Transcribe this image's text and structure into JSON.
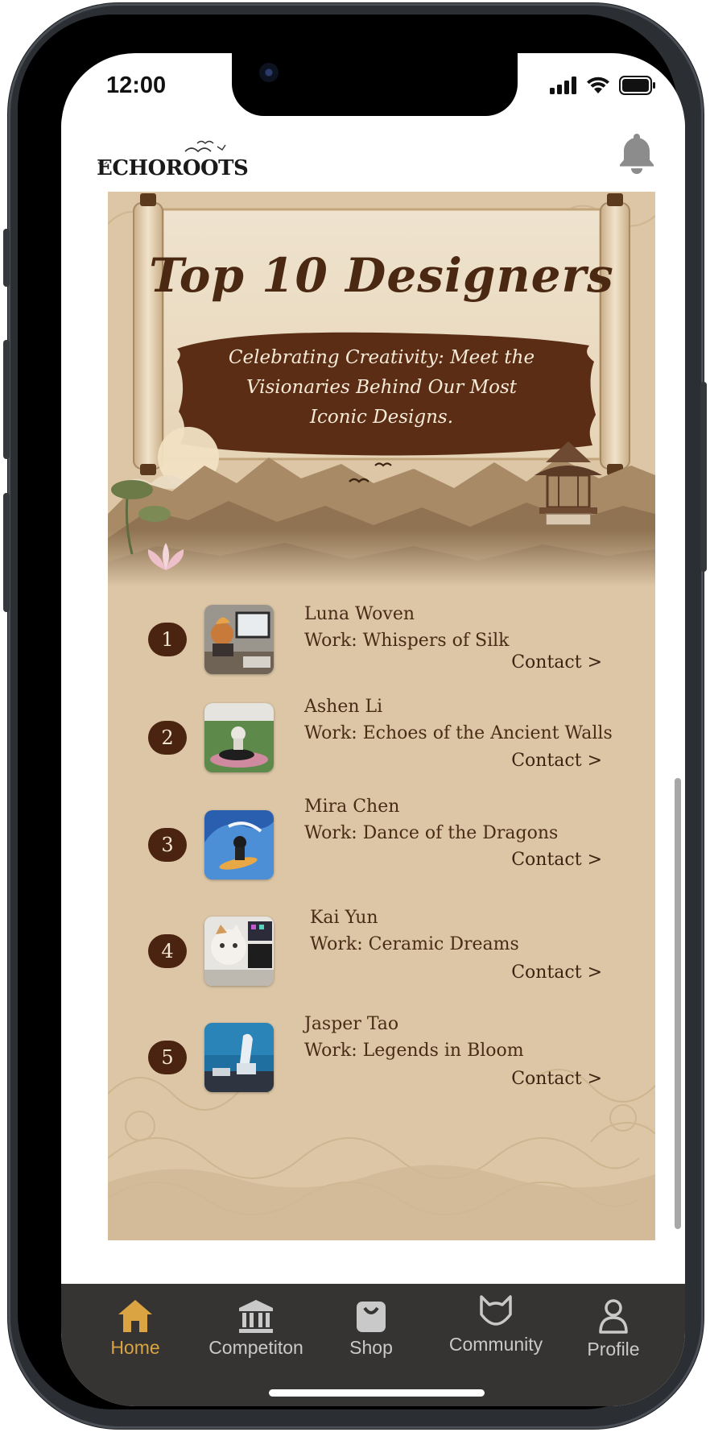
{
  "status_bar": {
    "time": "12:00"
  },
  "header": {
    "logo_text": "ECHOROOTS"
  },
  "hero": {
    "title": "Top 10 Designers",
    "subtitle": "Celebrating Creativity: Meet the Visionaries Behind Our Most Iconic Designs."
  },
  "designers": [
    {
      "rank": "1",
      "name": "Luna Woven",
      "work": "Work: Whispers of Silk",
      "contact": "Contact >",
      "thumb": "designer-at-computer"
    },
    {
      "rank": "2",
      "name": "Ashen Li",
      "work": "Work: Echoes of the Ancient Walls",
      "contact": "Contact >",
      "thumb": "cat-dj-turntable"
    },
    {
      "rank": "3",
      "name": "Mira Chen",
      "work": "Work: Dance of the Dragons",
      "contact": "Contact >",
      "thumb": "cat-surfing-wave"
    },
    {
      "rank": "4",
      "name": "Kai Yun",
      "work": "Work: Ceramic Dreams",
      "contact": "Contact >",
      "thumb": "cat-at-desk"
    },
    {
      "rank": "5",
      "name": "Jasper Tao",
      "work": "Work: Legends in Bloom",
      "contact": "Contact >",
      "thumb": "blue-room-figure"
    }
  ],
  "bottom_nav": {
    "items": [
      {
        "label": "Home",
        "icon": "home-icon",
        "active": true
      },
      {
        "label": "Competiton",
        "icon": "museum-icon",
        "active": false
      },
      {
        "label": "Shop",
        "icon": "shopping-bag-icon",
        "active": false
      },
      {
        "label": "Community",
        "icon": "cat-face-icon",
        "active": false
      },
      {
        "label": "Profile",
        "icon": "person-icon",
        "active": false
      }
    ]
  },
  "colors": {
    "accent": "#d9a441",
    "brown": "#4b2411",
    "parchment": "#dcc6a6",
    "nav_bg": "#353432"
  }
}
